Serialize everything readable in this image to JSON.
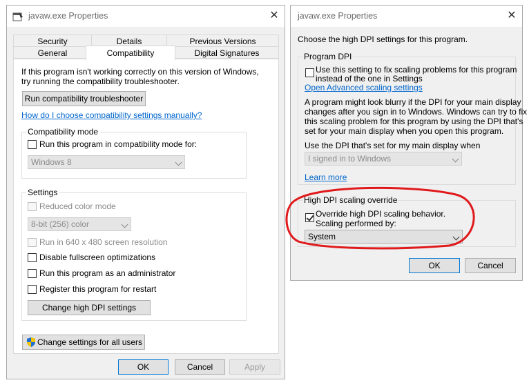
{
  "left_window": {
    "title": "javaw.exe Properties",
    "close_symbol": "✕",
    "tabs_row1": [
      "Security",
      "Details",
      "Previous Versions"
    ],
    "tabs_row2": [
      "General",
      "Compatibility",
      "Digital Signatures"
    ],
    "active_tab": "Compatibility",
    "intro_line1": "If this program isn't working correctly on this version of Windows,",
    "intro_line2": "try running the compatibility troubleshooter.",
    "troubleshooter_button": "Run compatibility troubleshooter",
    "help_link": "How do I choose compatibility settings manually?",
    "compat_mode": {
      "label": "Compatibility mode",
      "checkbox_label": "Run this program in compatibility mode for:",
      "checked": false,
      "os_select": "Windows 8"
    },
    "settings": {
      "label": "Settings",
      "reduced_color": "Reduced color mode",
      "color_select": "8-bit (256) color",
      "res_640": "Run in 640 x 480 screen resolution",
      "disable_fullscreen": "Disable fullscreen optimizations",
      "run_admin": "Run this program as an administrator",
      "register_restart": "Register this program for restart",
      "high_dpi_button": "Change high DPI settings"
    },
    "all_users_button": "Change settings for all users",
    "ok": "OK",
    "cancel": "Cancel",
    "apply": "Apply"
  },
  "right_window": {
    "title": "javaw.exe Properties",
    "close_symbol": "✕",
    "heading": "Choose the high DPI settings for this program.",
    "program_dpi": {
      "label": "Program DPI",
      "checkbox_line1": "Use this setting to fix scaling problems for this program",
      "checkbox_line2": "instead of the one in Settings",
      "checked": false,
      "advanced_link": "Open Advanced scaling settings",
      "para_line1": "A program might look blurry if the DPI for your main display",
      "para_line2": "changes after you sign in to Windows. Windows can try to fix",
      "para_line3": "this scaling problem for this program by using the DPI that's",
      "para_line4": "set for your main display when you open this program.",
      "use_dpi_label": "Use the DPI that's set for my main display when",
      "signin_select": "I signed in to Windows",
      "learn_more": "Learn more"
    },
    "override": {
      "label": "High DPI scaling override",
      "checkbox_line1": "Override high DPI scaling behavior.",
      "checkbox_line2": "Scaling performed by:",
      "checked": true,
      "scaling_select": "System"
    },
    "ok": "OK",
    "cancel": "Cancel"
  },
  "annotation_color": "#e0191b"
}
